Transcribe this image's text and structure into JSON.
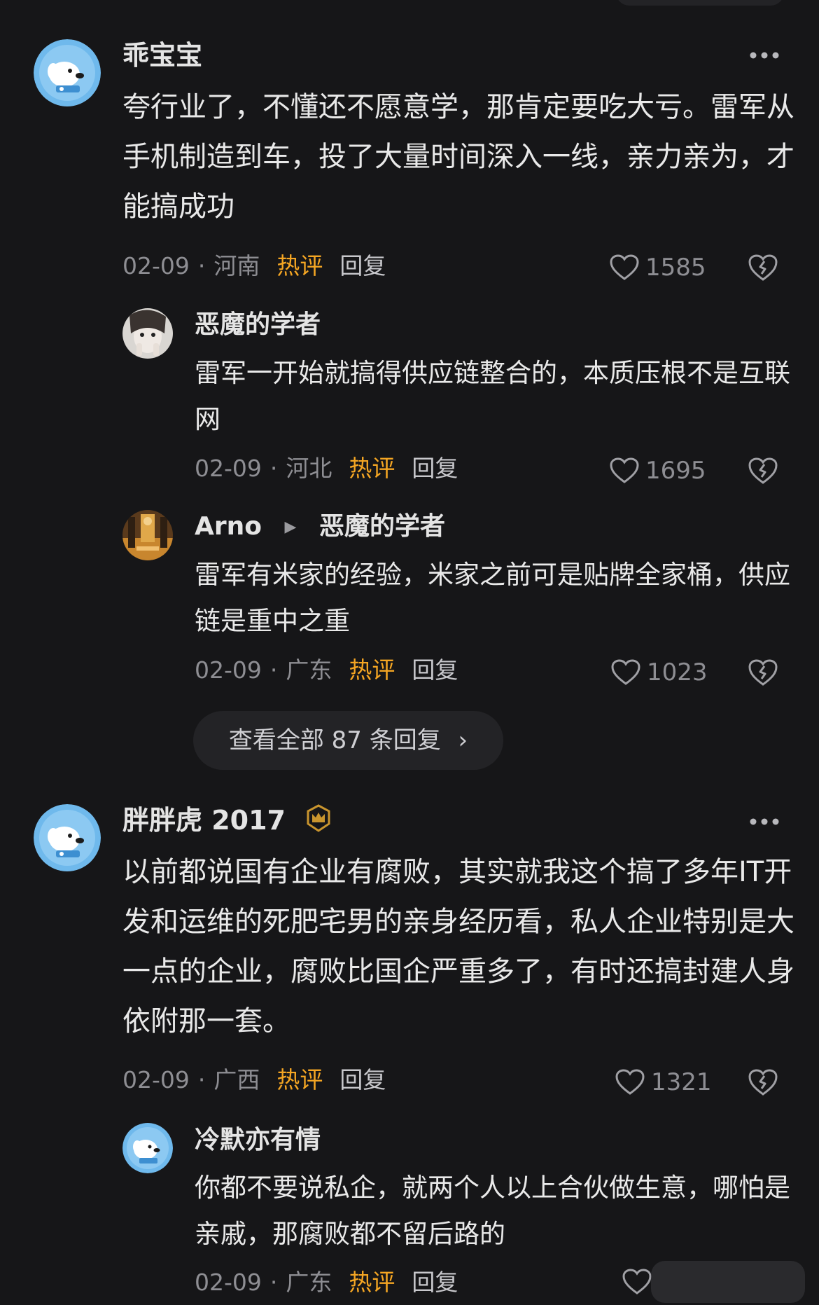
{
  "comments": [
    {
      "author": "乖宝宝",
      "body": "夸行业了，不懂还不愿意学，那肯定要吃大亏。雷军从手机制造到车，投了大量时间深入一线，亲力亲为，才能搞成功",
      "date": "02-09",
      "separator": "·",
      "region": "河南",
      "hot_label": "热评",
      "reply_label": "回复",
      "likes": "1585",
      "avatar_icon": "puppy-avatar-icon",
      "replies": [
        {
          "author": "恶魔的学者",
          "body": "雷军一开始就搞得供应链整合的，本质压根不是互联网",
          "date": "02-09",
          "separator": "·",
          "region": "河北",
          "hot_label": "热评",
          "reply_label": "回复",
          "likes": "1695",
          "avatar_icon": "photo-avatar-icon"
        },
        {
          "author": "Arno",
          "reply_to": "恶魔的学者",
          "body": "雷军有米家的经验，米家之前可是贴牌全家桶，供应链是重中之重",
          "date": "02-09",
          "separator": "·",
          "region": "广东",
          "hot_label": "热评",
          "reply_label": "回复",
          "likes": "1023",
          "avatar_icon": "photo-avatar-icon"
        }
      ],
      "expand_label": "查看全部 87 条回复"
    },
    {
      "author": "胖胖虎 2017",
      "badge_icon": "crown-badge-icon",
      "body": "以前都说国有企业有腐败，其实就我这个搞了多年IT开发和运维的死肥宅男的亲身经历看，私人企业特别是大一点的企业，腐败比国企严重多了，有时还搞封建人身依附那一套。",
      "date": "02-09",
      "separator": "·",
      "region": "广西",
      "hot_label": "热评",
      "reply_label": "回复",
      "likes": "1321",
      "avatar_icon": "puppy-avatar-icon",
      "replies": [
        {
          "author": "冷默亦有情",
          "body": "你都不要说私企，就两个人以上合伙做生意，哪怕是亲戚，那腐败都不留后路的",
          "date": "02-09",
          "separator": "·",
          "region": "广东",
          "hot_label": "热评",
          "reply_label": "回复",
          "avatar_icon": "puppy-avatar-icon"
        }
      ]
    }
  ],
  "colors": {
    "background": "#161618",
    "hot": "#f5a623",
    "muted": "#8e8e93",
    "avatar_blue": "#5aaee8"
  }
}
